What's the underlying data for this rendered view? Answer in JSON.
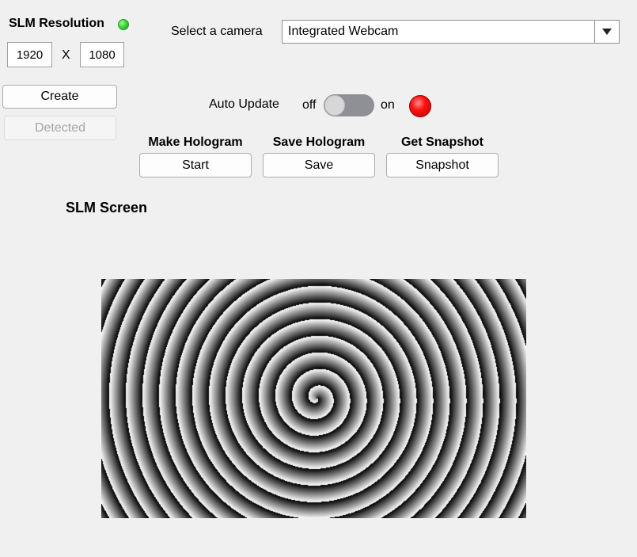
{
  "slm": {
    "title": "SLM Resolution",
    "status_color": "#3fd63a",
    "width": "1920",
    "separator": "X",
    "height": "1080",
    "create_label": "Create",
    "detected_label": "Detected"
  },
  "camera": {
    "label": "Select a camera",
    "selected": "Integrated Webcam"
  },
  "auto_update": {
    "label": "Auto Update",
    "off_label": "off",
    "on_label": "on",
    "state": "off",
    "lamp_color": "#ff1010"
  },
  "actions": [
    {
      "title": "Make Hologram",
      "button": "Start"
    },
    {
      "title": "Save Hologram",
      "button": "Save"
    },
    {
      "title": "Get Snapshot",
      "button": "Snapshot"
    }
  ],
  "screen": {
    "title": "SLM Screen"
  }
}
